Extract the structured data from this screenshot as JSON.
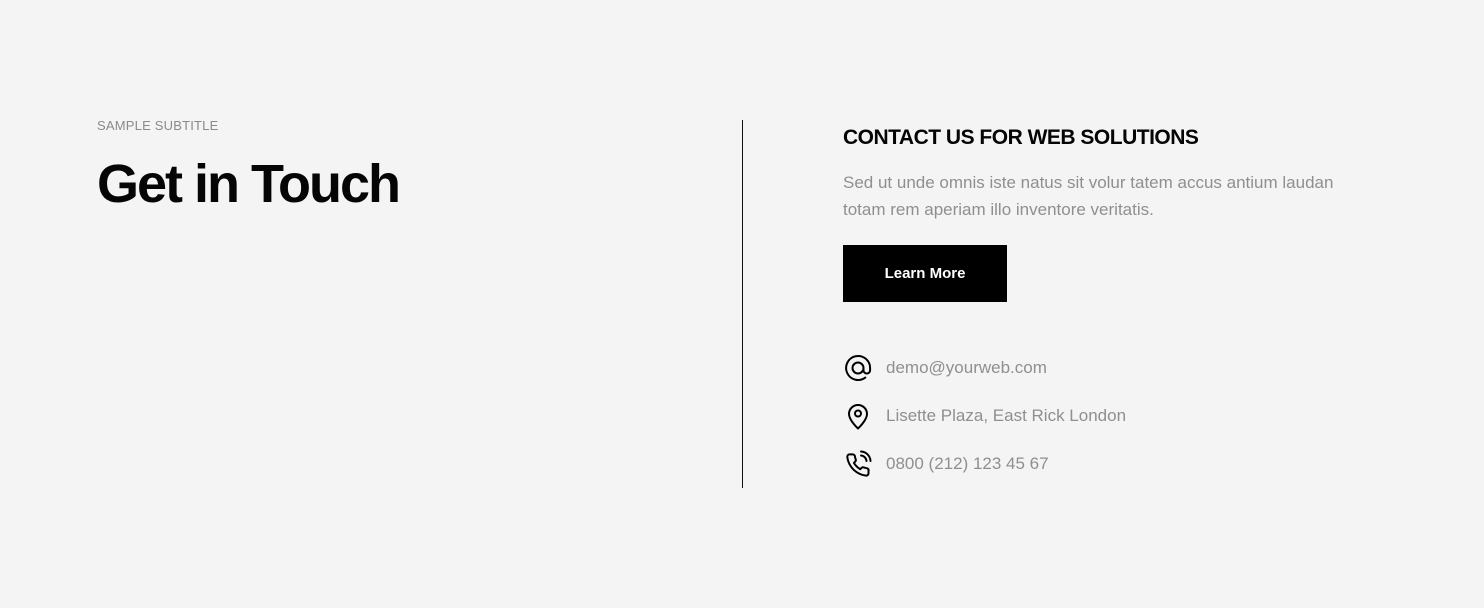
{
  "left": {
    "subtitle": "SAMPLE SUBTITLE",
    "title": "Get in Touch"
  },
  "right": {
    "heading": "CONTACT US FOR WEB SOLUTIONS",
    "description": "Sed ut unde omnis iste natus sit volur tatem accus antium laudan totam rem aperiam illo inventore veritatis.",
    "button_label": "Learn More"
  },
  "contacts": [
    {
      "icon": "at-icon",
      "text": "demo@yourweb.com"
    },
    {
      "icon": "map-pin-icon",
      "text": "Lisette Plaza, East Rick London"
    },
    {
      "icon": "phone-icon",
      "text": "0800 (212) 123 45 67"
    }
  ],
  "colors": {
    "background": "#f4f4f4",
    "text_primary": "#050505",
    "text_muted": "#8f8f8f",
    "button_bg": "#000000",
    "button_text": "#ffffff"
  }
}
